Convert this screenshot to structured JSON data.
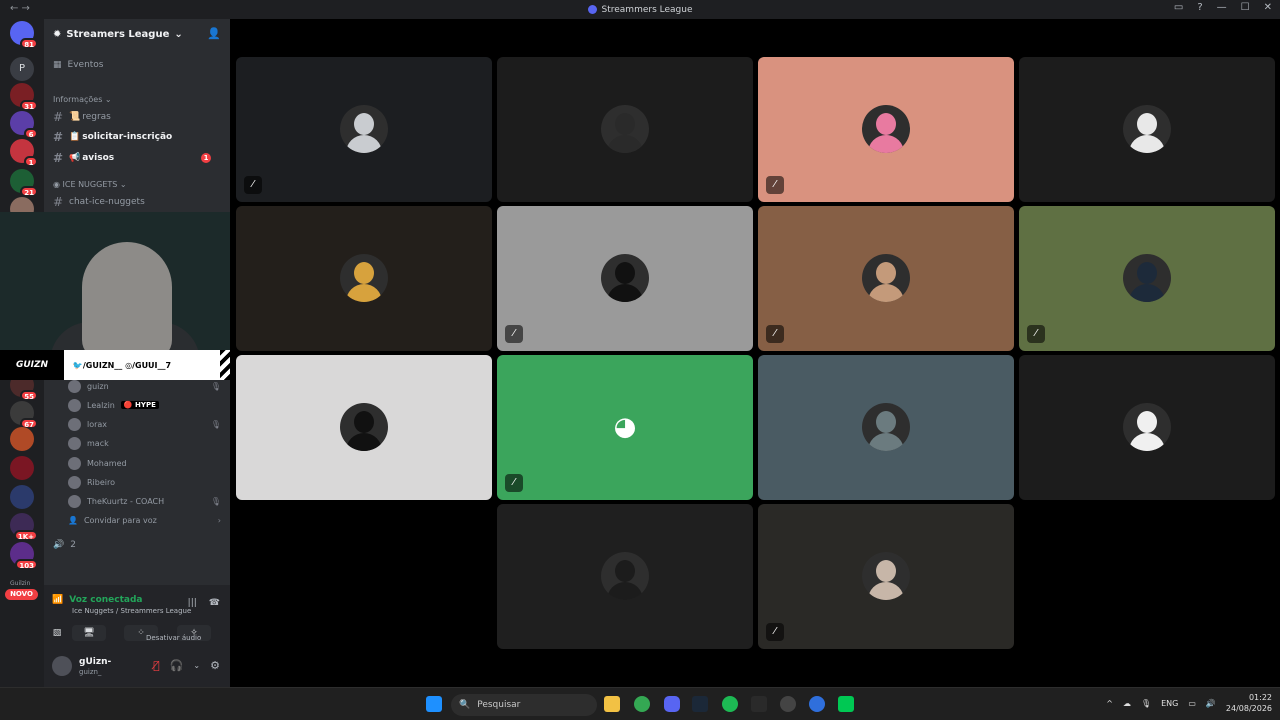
{
  "window": {
    "title": "Streammers League"
  },
  "servers": {
    "items": [
      {
        "badge": "81",
        "color": "#5865f2"
      },
      {
        "badge": "",
        "color": "#3a3d44",
        "letter": "P"
      },
      {
        "badge": "31",
        "color": "#7a1f24"
      },
      {
        "badge": "6",
        "color": "#5b3ea8"
      },
      {
        "badge": "1",
        "color": "#c4343f"
      },
      {
        "badge": "21",
        "color": "#1d5f35"
      },
      {
        "badge": "",
        "color": "#8a6c60"
      }
    ],
    "lower": [
      {
        "badge": "55",
        "color": "#4c2a2a"
      },
      {
        "badge": "67",
        "color": "#3b3b3b"
      },
      {
        "badge": "",
        "color": "#b04a26"
      },
      {
        "badge": "",
        "color": "#7a1623"
      },
      {
        "badge": "",
        "color": "#2b3a6b"
      },
      {
        "badge": "1K+",
        "color": "#3d2a55"
      },
      {
        "badge": "103",
        "color": "#5c2d8a"
      }
    ],
    "novo_label": "NOVO",
    "new_label": "Guilzin"
  },
  "sidebar": {
    "guild_name": "Streamers League",
    "events": "Eventos",
    "category_info": "Informações",
    "channels": [
      {
        "name": "regras",
        "emoji": "📜"
      },
      {
        "name": "solicitar-inscrição",
        "emoji": "📋"
      },
      {
        "name": "avisos",
        "emoji": "📢",
        "mention": "1"
      }
    ],
    "category_ice": "ICE NUGGETS",
    "chat_channel": "chat-ice-nuggets",
    "voice_users": [
      {
        "name": "guizn",
        "tag": "",
        "icon": "🎙"
      },
      {
        "name": "Lealzin",
        "tag": "🔴 HYPE",
        "icon": ""
      },
      {
        "name": "lorax",
        "tag": "",
        "icon": "🎙"
      },
      {
        "name": "mack",
        "tag": "",
        "icon": ""
      },
      {
        "name": "Mohamed",
        "tag": "",
        "icon": ""
      },
      {
        "name": "Ribeiro",
        "tag": "",
        "icon": ""
      },
      {
        "name": "TheKuurtz - COACH",
        "tag": "",
        "icon": "🎙"
      }
    ],
    "invite": "Convidar para voz",
    "voice_count": "2"
  },
  "voice": {
    "status": "Voz conectada",
    "location": "Ice Nuggets / Streammers League",
    "tooltip": "Desativar áudio"
  },
  "user": {
    "name": "gUizn-",
    "handle": "guizn_"
  },
  "cam_overlay": {
    "socials": "🐦/GUIZN__ ◎/GUUI__7",
    "logo": "GUIZN"
  },
  "tiles": [
    {
      "bg": "#1c1e21",
      "avatar": "#c9ccd0",
      "muted": true
    },
    {
      "bg": "#1c1c1c",
      "avatar": "#2a2a2a",
      "muted": false
    },
    {
      "bg": "#d9927f",
      "avatar": "#e87aa0",
      "muted": true
    },
    {
      "bg": "#1c1c1c",
      "avatar": "#e8e8e8",
      "muted": false
    },
    {
      "bg": "#231f1b",
      "avatar": "#d7a23d",
      "muted": false
    },
    {
      "bg": "#9a9a9a",
      "avatar": "#111111",
      "muted": true
    },
    {
      "bg": "#865f45",
      "avatar": "#c49a7a",
      "muted": true
    },
    {
      "bg": "#5f7043",
      "avatar": "#1d2a3a",
      "muted": true
    },
    {
      "bg": "#d9d8d8",
      "avatar": "#111111",
      "muted": false
    },
    {
      "bg": "#3ba55c",
      "avatar": "discord",
      "muted": true
    },
    {
      "bg": "#4a5b63",
      "avatar": "#6b7b7f",
      "muted": false
    },
    {
      "bg": "#1c1c1c",
      "avatar": "#f0f0f0",
      "muted": false
    },
    {
      "bg": "#1f1f1f",
      "avatar": "#1c1c1c",
      "muted": false
    },
    {
      "bg": "#2a2926",
      "avatar": "#c7b6a8",
      "muted": true
    }
  ],
  "taskbar": {
    "search": "Pesquisar",
    "lang": "ENG",
    "time": "01:22",
    "date": "24/08/2026"
  }
}
